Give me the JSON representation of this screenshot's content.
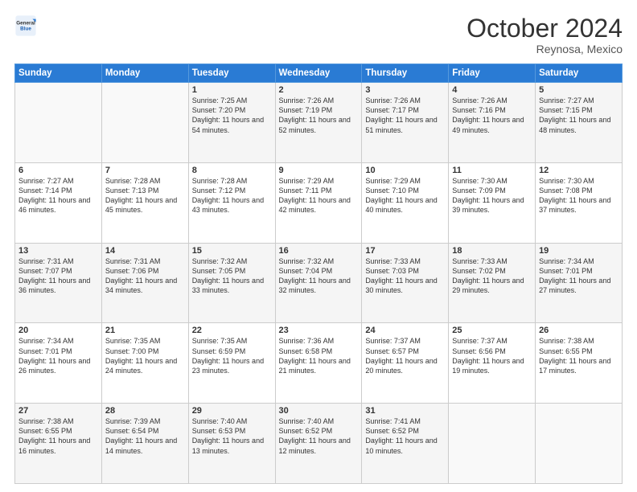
{
  "header": {
    "logo_general": "General",
    "logo_blue": "Blue",
    "month_title": "October 2024",
    "location": "Reynosa, Mexico"
  },
  "weekdays": [
    "Sunday",
    "Monday",
    "Tuesday",
    "Wednesday",
    "Thursday",
    "Friday",
    "Saturday"
  ],
  "weeks": [
    [
      {
        "day": "",
        "info": ""
      },
      {
        "day": "",
        "info": ""
      },
      {
        "day": "1",
        "info": "Sunrise: 7:25 AM\nSunset: 7:20 PM\nDaylight: 11 hours and 54 minutes."
      },
      {
        "day": "2",
        "info": "Sunrise: 7:26 AM\nSunset: 7:19 PM\nDaylight: 11 hours and 52 minutes."
      },
      {
        "day": "3",
        "info": "Sunrise: 7:26 AM\nSunset: 7:17 PM\nDaylight: 11 hours and 51 minutes."
      },
      {
        "day": "4",
        "info": "Sunrise: 7:26 AM\nSunset: 7:16 PM\nDaylight: 11 hours and 49 minutes."
      },
      {
        "day": "5",
        "info": "Sunrise: 7:27 AM\nSunset: 7:15 PM\nDaylight: 11 hours and 48 minutes."
      }
    ],
    [
      {
        "day": "6",
        "info": "Sunrise: 7:27 AM\nSunset: 7:14 PM\nDaylight: 11 hours and 46 minutes."
      },
      {
        "day": "7",
        "info": "Sunrise: 7:28 AM\nSunset: 7:13 PM\nDaylight: 11 hours and 45 minutes."
      },
      {
        "day": "8",
        "info": "Sunrise: 7:28 AM\nSunset: 7:12 PM\nDaylight: 11 hours and 43 minutes."
      },
      {
        "day": "9",
        "info": "Sunrise: 7:29 AM\nSunset: 7:11 PM\nDaylight: 11 hours and 42 minutes."
      },
      {
        "day": "10",
        "info": "Sunrise: 7:29 AM\nSunset: 7:10 PM\nDaylight: 11 hours and 40 minutes."
      },
      {
        "day": "11",
        "info": "Sunrise: 7:30 AM\nSunset: 7:09 PM\nDaylight: 11 hours and 39 minutes."
      },
      {
        "day": "12",
        "info": "Sunrise: 7:30 AM\nSunset: 7:08 PM\nDaylight: 11 hours and 37 minutes."
      }
    ],
    [
      {
        "day": "13",
        "info": "Sunrise: 7:31 AM\nSunset: 7:07 PM\nDaylight: 11 hours and 36 minutes."
      },
      {
        "day": "14",
        "info": "Sunrise: 7:31 AM\nSunset: 7:06 PM\nDaylight: 11 hours and 34 minutes."
      },
      {
        "day": "15",
        "info": "Sunrise: 7:32 AM\nSunset: 7:05 PM\nDaylight: 11 hours and 33 minutes."
      },
      {
        "day": "16",
        "info": "Sunrise: 7:32 AM\nSunset: 7:04 PM\nDaylight: 11 hours and 32 minutes."
      },
      {
        "day": "17",
        "info": "Sunrise: 7:33 AM\nSunset: 7:03 PM\nDaylight: 11 hours and 30 minutes."
      },
      {
        "day": "18",
        "info": "Sunrise: 7:33 AM\nSunset: 7:02 PM\nDaylight: 11 hours and 29 minutes."
      },
      {
        "day": "19",
        "info": "Sunrise: 7:34 AM\nSunset: 7:01 PM\nDaylight: 11 hours and 27 minutes."
      }
    ],
    [
      {
        "day": "20",
        "info": "Sunrise: 7:34 AM\nSunset: 7:01 PM\nDaylight: 11 hours and 26 minutes."
      },
      {
        "day": "21",
        "info": "Sunrise: 7:35 AM\nSunset: 7:00 PM\nDaylight: 11 hours and 24 minutes."
      },
      {
        "day": "22",
        "info": "Sunrise: 7:35 AM\nSunset: 6:59 PM\nDaylight: 11 hours and 23 minutes."
      },
      {
        "day": "23",
        "info": "Sunrise: 7:36 AM\nSunset: 6:58 PM\nDaylight: 11 hours and 21 minutes."
      },
      {
        "day": "24",
        "info": "Sunrise: 7:37 AM\nSunset: 6:57 PM\nDaylight: 11 hours and 20 minutes."
      },
      {
        "day": "25",
        "info": "Sunrise: 7:37 AM\nSunset: 6:56 PM\nDaylight: 11 hours and 19 minutes."
      },
      {
        "day": "26",
        "info": "Sunrise: 7:38 AM\nSunset: 6:55 PM\nDaylight: 11 hours and 17 minutes."
      }
    ],
    [
      {
        "day": "27",
        "info": "Sunrise: 7:38 AM\nSunset: 6:55 PM\nDaylight: 11 hours and 16 minutes."
      },
      {
        "day": "28",
        "info": "Sunrise: 7:39 AM\nSunset: 6:54 PM\nDaylight: 11 hours and 14 minutes."
      },
      {
        "day": "29",
        "info": "Sunrise: 7:40 AM\nSunset: 6:53 PM\nDaylight: 11 hours and 13 minutes."
      },
      {
        "day": "30",
        "info": "Sunrise: 7:40 AM\nSunset: 6:52 PM\nDaylight: 11 hours and 12 minutes."
      },
      {
        "day": "31",
        "info": "Sunrise: 7:41 AM\nSunset: 6:52 PM\nDaylight: 11 hours and 10 minutes."
      },
      {
        "day": "",
        "info": ""
      },
      {
        "day": "",
        "info": ""
      }
    ]
  ]
}
